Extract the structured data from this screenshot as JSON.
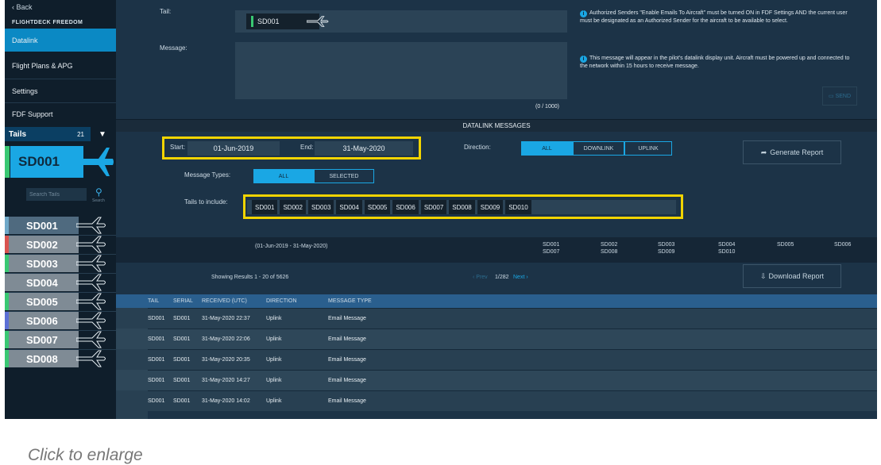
{
  "sidebar": {
    "back": "‹ Back",
    "brand": "FLIGHTDECK FREEDOM",
    "nav": [
      "Datalink",
      "Flight Plans & APG",
      "Settings",
      "FDF Support"
    ],
    "tails_label": "Tails",
    "tails_count": "21",
    "selected_tail": "SD001",
    "search_placeholder": "Search Tails",
    "search_caption": "Search",
    "tails": [
      "SD001",
      "SD002",
      "SD003",
      "SD004",
      "SD005",
      "SD006",
      "SD007",
      "SD008"
    ],
    "tail_strip_colors": [
      "#6fa8c8",
      "#d9534f",
      "#39c872",
      "#7f8b95",
      "#39c872",
      "#5b6fd6",
      "#39c872",
      "#39c872"
    ]
  },
  "compose": {
    "tail_label": "Tail:",
    "message_label": "Message:",
    "tail_value": "SD001",
    "char_count": "(0 / 1000)",
    "info_1": "Authorized Senders \"Enable Emails To Aircraft\" must be turned ON in FDF Settings AND the current user must be designated as an Authorized Sender for the aircraft to be available to select.",
    "info_2": "This message will appear in the pilot's datalink display unit. Aircraft must be powered up and connected to the network within 15 hours to receive message.",
    "send_label": "SEND"
  },
  "messages": {
    "section_title": "DATALINK MESSAGES",
    "start_label": "Start:",
    "start_value": "01-Jun-2019",
    "end_label": "End:",
    "end_value": "31-May-2020",
    "direction_label": "Direction:",
    "direction_options": [
      "ALL",
      "DOWNLINK",
      "UPLINK"
    ],
    "generate_report": "Generate Report",
    "message_types_label": "Message Types:",
    "message_types_options": [
      "ALL",
      "SELECTED"
    ],
    "tails_include_label": "Tails to include:",
    "tails_include": [
      "SD001",
      "SD002",
      "SD003",
      "SD004",
      "SD005",
      "SD006",
      "SD007",
      "SD008",
      "SD009",
      "SD010"
    ],
    "range_text": "(01-Jun-2019 - 31-May-2020)",
    "range_tails": [
      [
        "SD001",
        "SD007"
      ],
      [
        "SD002",
        "SD008"
      ],
      [
        "SD003",
        "SD009"
      ],
      [
        "SD004",
        "SD010"
      ],
      [
        "SD005",
        ""
      ],
      [
        "SD006",
        ""
      ]
    ],
    "results_text": "Showing Results 1 - 20 of 5626",
    "prev_label": "‹ Prev",
    "page_label": "1/282",
    "next_label": "Next ›",
    "download_report": "Download Report",
    "columns": [
      "TAIL",
      "SERIAL",
      "RECEIVED (UTC)",
      "DIRECTION",
      "MESSAGE TYPE"
    ],
    "rows": [
      [
        "SD001",
        "SD001",
        "31-May-2020 22:37",
        "Uplink",
        "Email Message"
      ],
      [
        "SD001",
        "SD001",
        "31-May-2020 22:06",
        "Uplink",
        "Email Message"
      ],
      [
        "SD001",
        "SD001",
        "31-May-2020 20:35",
        "Uplink",
        "Email Message"
      ],
      [
        "SD001",
        "SD001",
        "31-May-2020 14:27",
        "Uplink",
        "Email Message"
      ],
      [
        "SD001",
        "SD001",
        "31-May-2020 14:02",
        "Uplink",
        "Email Message"
      ]
    ]
  },
  "caption": "Click to enlarge",
  "colors": {
    "accent": "#1aa7e4",
    "highlight": "#f1d400",
    "panel": "#1c3347"
  }
}
